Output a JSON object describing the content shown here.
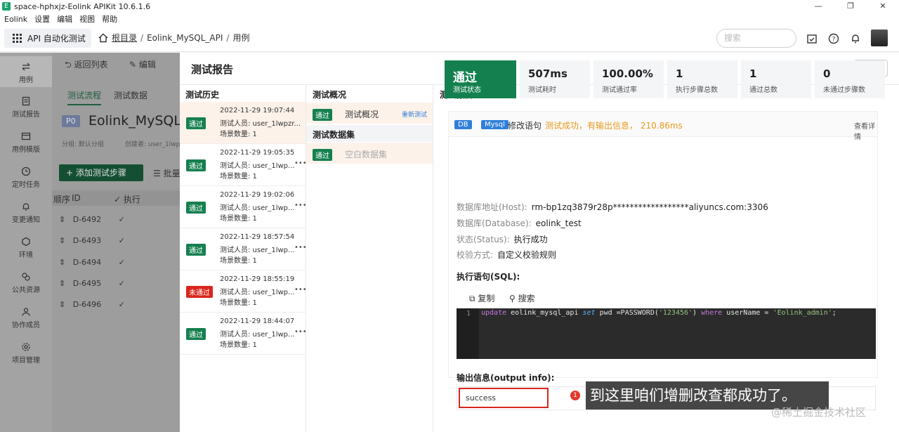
{
  "window": {
    "title": "space-hphxjz-Eolink APIKit 10.6.1.6",
    "icon_letter": "E",
    "buttons": [
      "—",
      "❐",
      "✕"
    ]
  },
  "menubar": [
    "Eolink",
    "设置",
    "编辑",
    "视图",
    "帮助"
  ],
  "topnav": {
    "module": "API 自动化测试",
    "breadcrumb": {
      "root": "根目录",
      "sep": "/",
      "api": "Eolink_MySQL_API",
      "current": "用例"
    },
    "search_placeholder": "搜索"
  },
  "sidebar": [
    {
      "label": "用例",
      "icon": "swap-icon"
    },
    {
      "label": "测试报告",
      "icon": "report-icon"
    },
    {
      "label": "用例模版",
      "icon": "template-icon"
    },
    {
      "label": "定时任务",
      "icon": "clock-icon"
    },
    {
      "label": "变更通知",
      "icon": "bell-icon"
    },
    {
      "label": "环境",
      "icon": "environment-icon"
    },
    {
      "label": "公共资源",
      "icon": "resource-icon"
    },
    {
      "label": "协作成员",
      "icon": "members-icon"
    },
    {
      "label": "项目管理",
      "icon": "settings-icon"
    }
  ],
  "workspace": {
    "back": "返回列表",
    "edit": "编辑",
    "tabs": [
      "测试流程",
      "测试数据"
    ],
    "priority": "P0",
    "name": "Eolink_MySQL",
    "group": "分组: 默认分组",
    "creator": "创建者: user_1lwp",
    "add_step": "+ 添加测试步骤",
    "batch": "批量",
    "table_headers": [
      "顺序",
      "ID",
      "执行"
    ],
    "rows": [
      "D-6492",
      "D-6493",
      "D-6494",
      "D-6495",
      "D-6496"
    ]
  },
  "drawer": {
    "title": "测试报告",
    "close": "关闭",
    "history_title": "测试历史",
    "overview_title": "测试概况",
    "report_title": "测试报告",
    "history": [
      {
        "status": "通过",
        "pass": true,
        "time": "2022-11-29 19:07:44",
        "tester": "测试人员: user_1lwpzr...",
        "count": "场景数量: 1",
        "more": ""
      },
      {
        "status": "通过",
        "pass": true,
        "time": "2022-11-29 19:05:35",
        "tester": "测试人员: user_1lwp...",
        "count": "场景数量: 1",
        "more": "•••"
      },
      {
        "status": "通过",
        "pass": true,
        "time": "2022-11-29 19:02:06",
        "tester": "测试人员: user_1lwp...",
        "count": "场景数量: 1",
        "more": "•••"
      },
      {
        "status": "通过",
        "pass": true,
        "time": "2022-11-29 18:57:54",
        "tester": "测试人员: user_1lwp...",
        "count": "场景数量: 1",
        "more": "•••"
      },
      {
        "status": "未通过",
        "pass": false,
        "time": "2022-11-29 18:55:19",
        "tester": "测试人员: user_1lwp...",
        "count": "场景数量: 1",
        "more": "•••"
      },
      {
        "status": "通过",
        "pass": true,
        "time": "2022-11-29 18:44:07",
        "tester": "测试人员: user_1lwp...",
        "count": "场景数量: 1",
        "more": "•••"
      }
    ],
    "overview": {
      "row_status": "通过",
      "row_label": "测试概况",
      "retest": "重新测试",
      "dataset_title": "测试数据集",
      "dataset_status": "通过",
      "dataset_label": "空白数据集"
    },
    "stats": [
      {
        "value": "通过",
        "label": "测试状态"
      },
      {
        "value": "507ms",
        "label": "测试耗时"
      },
      {
        "value": "100.00%",
        "label": "测试通过率"
      },
      {
        "value": "1",
        "label": "执行步骤总数"
      },
      {
        "value": "1",
        "label": "通过总数"
      },
      {
        "value": "0",
        "label": "未通过步骤数"
      }
    ],
    "detail": {
      "tag_db": "DB",
      "tag_mysql": "Mysql",
      "action": "修改语句",
      "result": "测试成功，有输出信息，",
      "duration": "210.86ms",
      "view_detail": "查看详情",
      "host_key": "数据库地址(Host):",
      "host_val": "rm-bp1zq3879r28p******************aliyuncs.com:3306",
      "db_key": "数据库(Database):",
      "db_val": "eolink_test",
      "status_key": "状态(Status):",
      "status_val": "执行成功",
      "verify_key": "校验方式:",
      "verify_val": "自定义校验规则",
      "sql_title": "执行语句(SQL):",
      "copy": "复制",
      "search": "搜索",
      "line_no": "1",
      "sql": {
        "kw1": "update",
        "t1": " eolink_mysql_api ",
        "kw2": "set",
        "t2": " pwd =PASSWORD(",
        "s1": "'123456'",
        "t3": ") ",
        "kw3": "where",
        "t4": " userName = ",
        "s2": "'Eolink_admin'",
        "t5": ";"
      },
      "output_title": "输出信息(output info):",
      "output": "success"
    },
    "annotation": {
      "number": "1",
      "text": "到这里咱们增删改查都成功了。"
    },
    "watermark": "@稀土掘金技术社区"
  }
}
